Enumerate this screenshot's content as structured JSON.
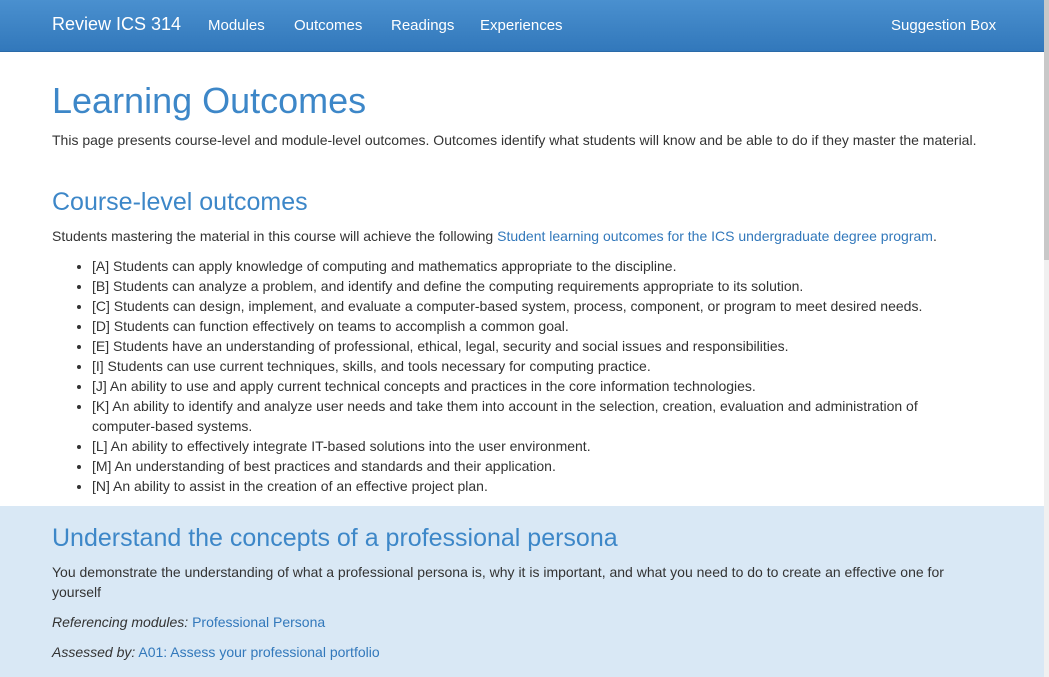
{
  "navbar": {
    "brand": "Review ICS 314",
    "links": [
      "Modules",
      "Outcomes",
      "Readings",
      "Experiences"
    ],
    "right_link": "Suggestion Box"
  },
  "page": {
    "title": "Learning Outcomes",
    "intro": "This page presents course-level and module-level outcomes. Outcomes identify what students will know and be able to do if they master the material."
  },
  "course_level": {
    "heading": "Course-level outcomes",
    "intro_text": "Students mastering the material in this course will achieve the following ",
    "intro_link": "Student learning outcomes for the ICS undergraduate degree program",
    "intro_suffix": ".",
    "items": [
      "[A] Students can apply knowledge of computing and mathematics appropriate to the discipline.",
      "[B] Students can analyze a problem, and identify and define the computing requirements appropriate to its solution.",
      "[C] Students can design, implement, and evaluate a computer-based system, process, component, or program to meet desired needs.",
      "[D] Students can function effectively on teams to accomplish a common goal.",
      "[E] Students have an understanding of professional, ethical, legal, security and social issues and responsibilities.",
      "[I] Students can use current techniques, skills, and tools necessary for computing practice.",
      "[J] An ability to use and apply current technical concepts and practices in the core information technologies.",
      "[K] An ability to identify and analyze user needs and take them into account in the selection, creation, evaluation and administration of computer-based systems.",
      "[L] An ability to effectively integrate IT-based solutions into the user environment.",
      "[M] An understanding of best practices and standards and their application.",
      "[N] An ability to assist in the creation of an effective project plan."
    ]
  },
  "outcome_panel": {
    "heading": "Understand the concepts of a professional persona",
    "description": "You demonstrate the understanding of what a professional persona is, why it is important, and what you need to do to create an effective one for yourself",
    "referencing_label": "Referencing modules:",
    "referencing_link": "Professional Persona",
    "assessed_label": "Assessed by:",
    "assessed_link": "A01: Assess your professional portfolio"
  }
}
